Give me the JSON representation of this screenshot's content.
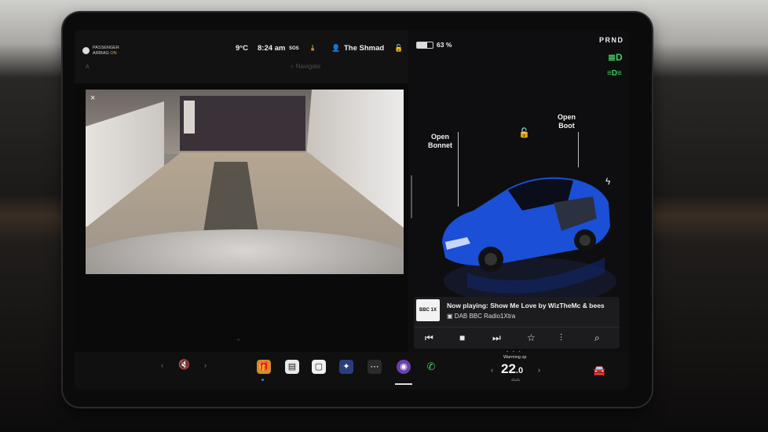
{
  "status": {
    "airbag_line1": "PASSENGER",
    "airbag_line2": "AIRBAG",
    "airbag_state": "ON",
    "temperature": "9°C",
    "time": "8:24 am",
    "sos": "SOS",
    "profile": "The Shmad",
    "battery": "63 %",
    "battery_percent": 63,
    "gear": "PRND",
    "search_placeholder": "Navigate",
    "fan_label": "A"
  },
  "car": {
    "open_bonnet": "Open\nBonnet",
    "open_bonnet_l1": "Open",
    "open_bonnet_l2": "Bonnet",
    "open_boot_l1": "Open",
    "open_boot_l2": "Boot",
    "car_color": "#1a4fd6"
  },
  "media": {
    "art_text": "BBC 1X",
    "now_playing": "Now playing: Show Me Love by WizTheMc & bees",
    "station": "DAB BBC Radio1Xtra"
  },
  "climate": {
    "caption": "Warming up",
    "temp_main": "22",
    "temp_decimal": ".0"
  },
  "icons": {
    "close": "×",
    "chevron_up": "⌃"
  }
}
